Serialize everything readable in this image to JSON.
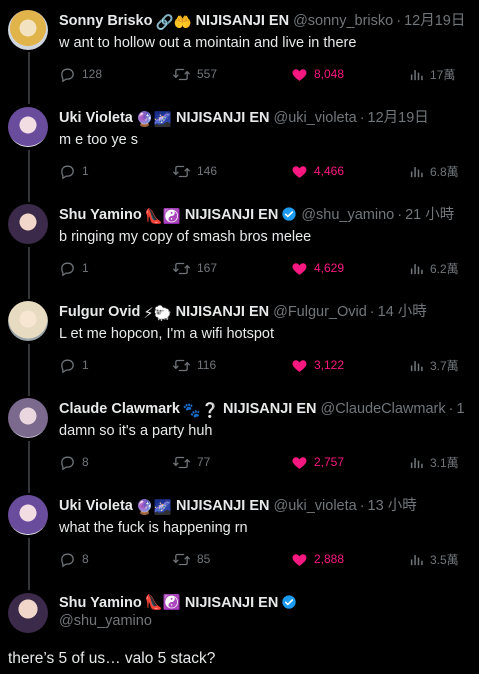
{
  "tweets": [
    {
      "name": "Sonny Brisko",
      "emoji": "🔗🤲",
      "org": "NIJISANJI EN",
      "handle": "@sonny_brisko",
      "time": "12月19日",
      "text": "w ant to hollow out a mointain and live in there",
      "replies": "128",
      "retweets": "557",
      "likes": "8,048",
      "views": "17萬"
    },
    {
      "name": "Uki Violeta",
      "emoji": "🔮🌌",
      "org": "NIJISANJI EN",
      "handle": "@uki_violeta",
      "time": "12月19日",
      "text": "m e too ye s",
      "replies": "1",
      "retweets": "146",
      "likes": "4,466",
      "views": "6.8萬"
    },
    {
      "name": "Shu Yamino",
      "emoji": "👠☯️",
      "org": "NIJISANJI EN",
      "handle": "@shu_yamino",
      "time": "21 小時",
      "text": "b ringing my copy of smash bros melee",
      "replies": "1",
      "retweets": "167",
      "likes": "4,629",
      "views": "6.2萬"
    },
    {
      "name": "Fulgur Ovid",
      "emoji": "⚡🐑",
      "org": "NIJISANJI EN",
      "handle": "@Fulgur_Ovid",
      "time": "14 小時",
      "text": "L et me hopcon, I'm a wifi hotspot",
      "replies": "1",
      "retweets": "116",
      "likes": "3,122",
      "views": "3.7萬"
    },
    {
      "name": "Claude Clawmark",
      "emoji": "🐾❔",
      "org": "NIJISANJI EN",
      "handle": "@ClaudeClawmark",
      "time": "1",
      "text": "damn so it's a party huh",
      "replies": "8",
      "retweets": "77",
      "likes": "2,757",
      "views": "3.1萬"
    },
    {
      "name": "Uki Violeta",
      "emoji": "🔮🌌",
      "org": "NIJISANJI EN",
      "handle": "@uki_violeta",
      "time": "13 小時",
      "text": "what the fuck is happening rn",
      "replies": "8",
      "retweets": "85",
      "likes": "2,888",
      "views": "3.5萬"
    }
  ],
  "final": {
    "name": "Shu Yamino",
    "emoji": "👠☯️",
    "org": "NIJISANJI EN",
    "handle": "@shu_yamino",
    "text": "there’s 5 of us… valo 5 stack?"
  },
  "colors": {
    "background": "#000000",
    "text": "#e7e9ea",
    "muted": "#71767b",
    "like": "#f91880",
    "verified": "#1d9bf0",
    "thread": "#333639"
  }
}
